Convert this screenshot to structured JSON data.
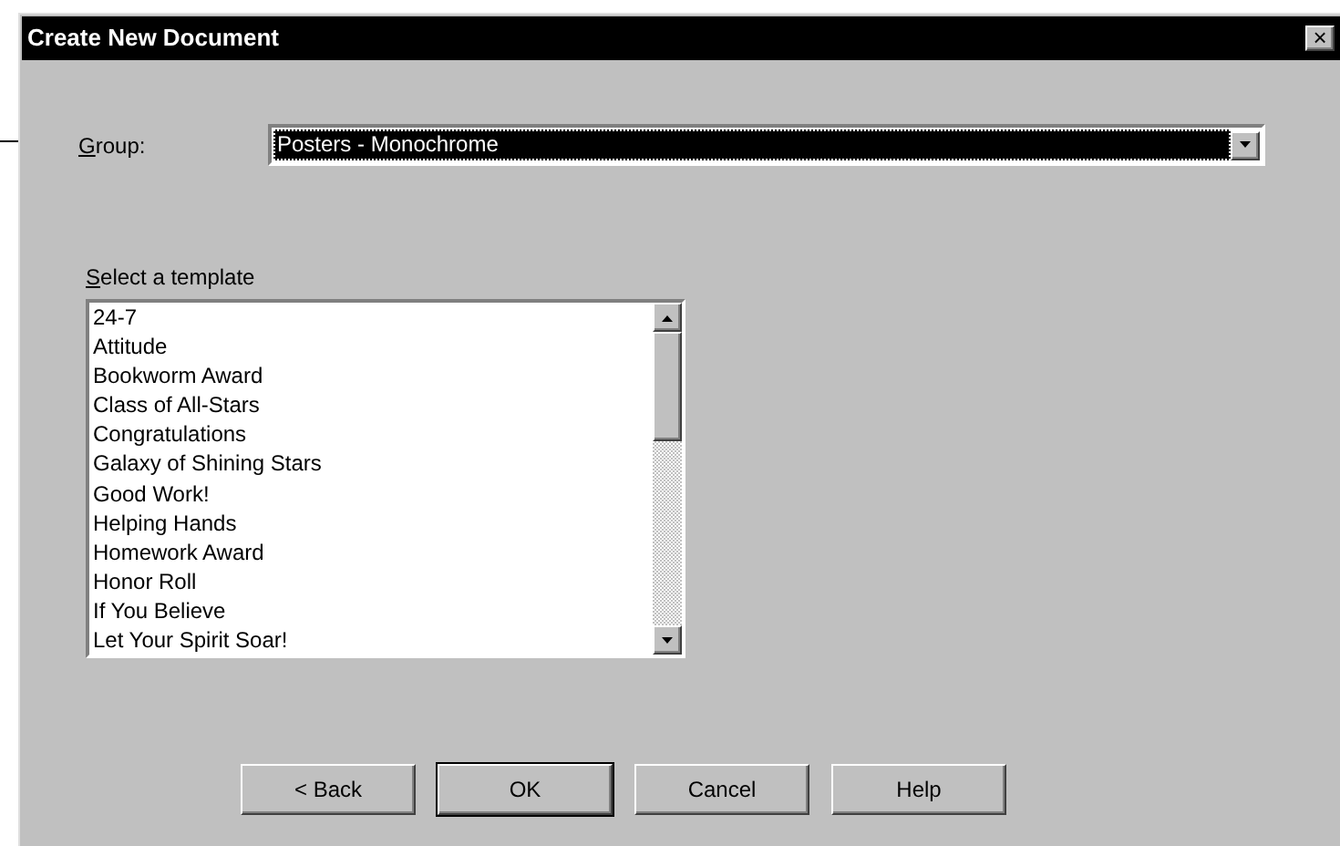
{
  "window": {
    "title": "Create New Document",
    "close": "×"
  },
  "group": {
    "label": "Group:",
    "value": "Posters - Monochrome",
    "focused": true
  },
  "templates": {
    "label": "Select a template",
    "items": [
      {
        "text": "24-7",
        "selected": false
      },
      {
        "text": "Attitude",
        "selected": false
      },
      {
        "text": "Bookworm Award",
        "selected": false
      },
      {
        "text": "Class of All-Stars",
        "selected": false
      },
      {
        "text": "Congratulations",
        "selected": false
      },
      {
        "text": "Galaxy of Shining Stars",
        "selected": false
      },
      {
        "text": "Good Work!",
        "selected": false
      },
      {
        "text": "Helping Hands",
        "selected": false
      },
      {
        "text": "Homework Award",
        "selected": false
      },
      {
        "text": "Honor Roll",
        "selected": false
      },
      {
        "text": "If You Believe",
        "selected": false
      },
      {
        "text": "Let Your Spirit Soar!",
        "selected": false
      }
    ]
  },
  "buttons": [
    {
      "label": "< Back",
      "default": false
    },
    {
      "label": "OK",
      "default": true
    },
    {
      "label": "Cancel",
      "default": false
    },
    {
      "label": "Help",
      "default": false
    }
  ]
}
